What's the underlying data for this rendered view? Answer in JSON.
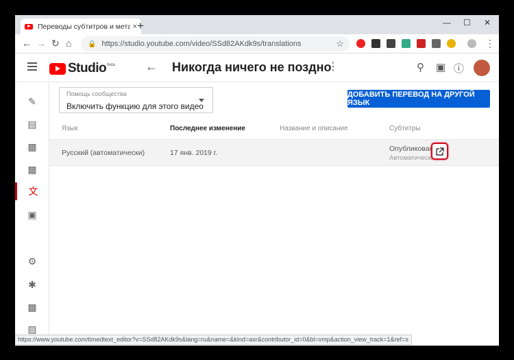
{
  "browser": {
    "tab_title": "Переводы субтитров и метадан",
    "tab_close": "×",
    "new_tab": "+",
    "url": "https://studio.youtube.com/video/SSd82AKdk9s/translations",
    "status_url": "https://www.youtube.com/timedtext_editor?v=SSd82AKdk9s&lang=ru&name=&kind=asr&contributor_id=0&bl=vmp&action_view_track=1&ref=s"
  },
  "header": {
    "logo_text": "Studio",
    "beta": "beta",
    "video_title": "Никогда ничего не поздно"
  },
  "toolbar": {
    "dropdown_label": "Помощь сообщества",
    "dropdown_value": "Включить функцию для этого видео",
    "add_button": "ДОБАВИТЬ ПЕРЕВОД НА ДРУГОЙ ЯЗЫК"
  },
  "table": {
    "headers": [
      "Язык",
      "Последнее изменение",
      "Название и описание",
      "Субтитры"
    ],
    "rows": [
      {
        "language": "Русский (автоматически)",
        "modified": "17 янв. 2019 г.",
        "title_desc": "",
        "subtitles": "Опубликовано",
        "subtitles_note": "Автоматически"
      }
    ]
  },
  "colors": {
    "accent": "#065fd4",
    "brand": "#ff0000",
    "active_nav": "#cc0000",
    "highlight": "#d10f24"
  },
  "icons": {
    "rail": [
      "edit-icon",
      "analytics-icon",
      "video-icon",
      "comments-icon",
      "translate-icon",
      "copyright-icon",
      "settings-icon",
      "feedback-icon",
      "report-icon",
      "classic-studio-icon"
    ]
  }
}
